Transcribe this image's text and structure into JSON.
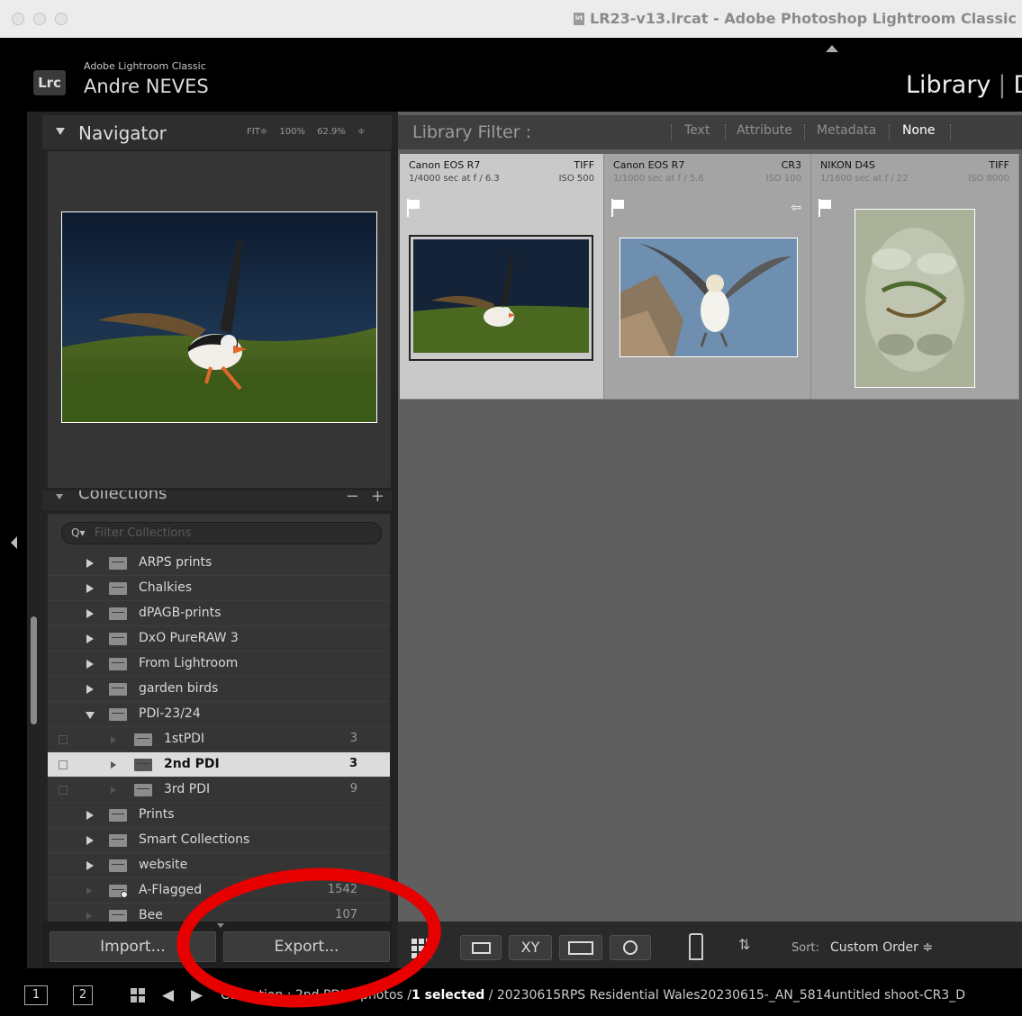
{
  "window": {
    "title": "LR23-v13.lrcat - Adobe Photoshop Lightroom Classic",
    "doc_icon_text": "lrt"
  },
  "identity_plate": {
    "logo": "Lrc",
    "app_name": "Adobe Lightroom Classic",
    "user_name": "Andre NEVES"
  },
  "modules": {
    "active": "Library",
    "separator": "|",
    "next": "D"
  },
  "navigator": {
    "title": "Navigator",
    "zoom_options": "FIT≑ 100% 62.9% ≑",
    "preview_subject": "puffin with sand eels in flight over grass"
  },
  "collections": {
    "title": "Collections",
    "minus": "−",
    "plus": "+",
    "search_placeholder": "Filter Collections",
    "items": [
      {
        "label": "ARPS prints",
        "count": ""
      },
      {
        "label": "Chalkies",
        "count": ""
      },
      {
        "label": "dPAGB-prints",
        "count": ""
      },
      {
        "label": "DxO PureRAW 3",
        "count": ""
      },
      {
        "label": "From Lightroom",
        "count": ""
      },
      {
        "label": "garden birds",
        "count": ""
      },
      {
        "label": "PDI-23/24",
        "count": ""
      },
      {
        "label": "1stPDI",
        "count": "3"
      },
      {
        "label": "2nd PDI",
        "count": "3"
      },
      {
        "label": "3rd PDI",
        "count": "9"
      },
      {
        "label": "Prints",
        "count": ""
      },
      {
        "label": "Smart Collections",
        "count": ""
      },
      {
        "label": "website",
        "count": ""
      },
      {
        "label": "A-Flagged",
        "count": "1542"
      },
      {
        "label": "Bee",
        "count": "107"
      }
    ],
    "selected_index": 8
  },
  "buttons": {
    "import": "Import...",
    "export": "Export..."
  },
  "library_filter": {
    "title": "Library Filter :",
    "tabs": [
      "Text",
      "Attribute",
      "Metadata",
      "None"
    ],
    "active": "None"
  },
  "grid": {
    "cells": [
      {
        "camera": "Canon EOS R7",
        "format": "TIFF",
        "exposure": "1/4000 sec at f / 6.3",
        "iso": "ISO 500",
        "selected": true
      },
      {
        "camera": "Canon EOS R7",
        "format": "CR3",
        "exposure": "1/1000 sec at f / 5.6",
        "iso": "ISO 100",
        "selected": false
      },
      {
        "camera": "NIKON D4S",
        "format": "TIFF",
        "exposure": "1/1600 sec at f / 22",
        "iso": "ISO 8000",
        "selected": false
      }
    ]
  },
  "toolbar": {
    "sort_label": "Sort:",
    "sort_value": "Custom Order ≑",
    "compare_label": "XY"
  },
  "filmstrip": {
    "screen1": "1",
    "screen2": "2",
    "source_prefix": "Collection : 2nd PDI",
    "count": "3 photos /",
    "selected": "1 selected",
    "filename": "/ 20230615RPS Residential Wales20230615-_AN_5814untitled shoot-CR3_D"
  },
  "colors": {
    "annotation": "#e60000",
    "panel": "#353535",
    "grid_bg": "#5f5f5f"
  }
}
